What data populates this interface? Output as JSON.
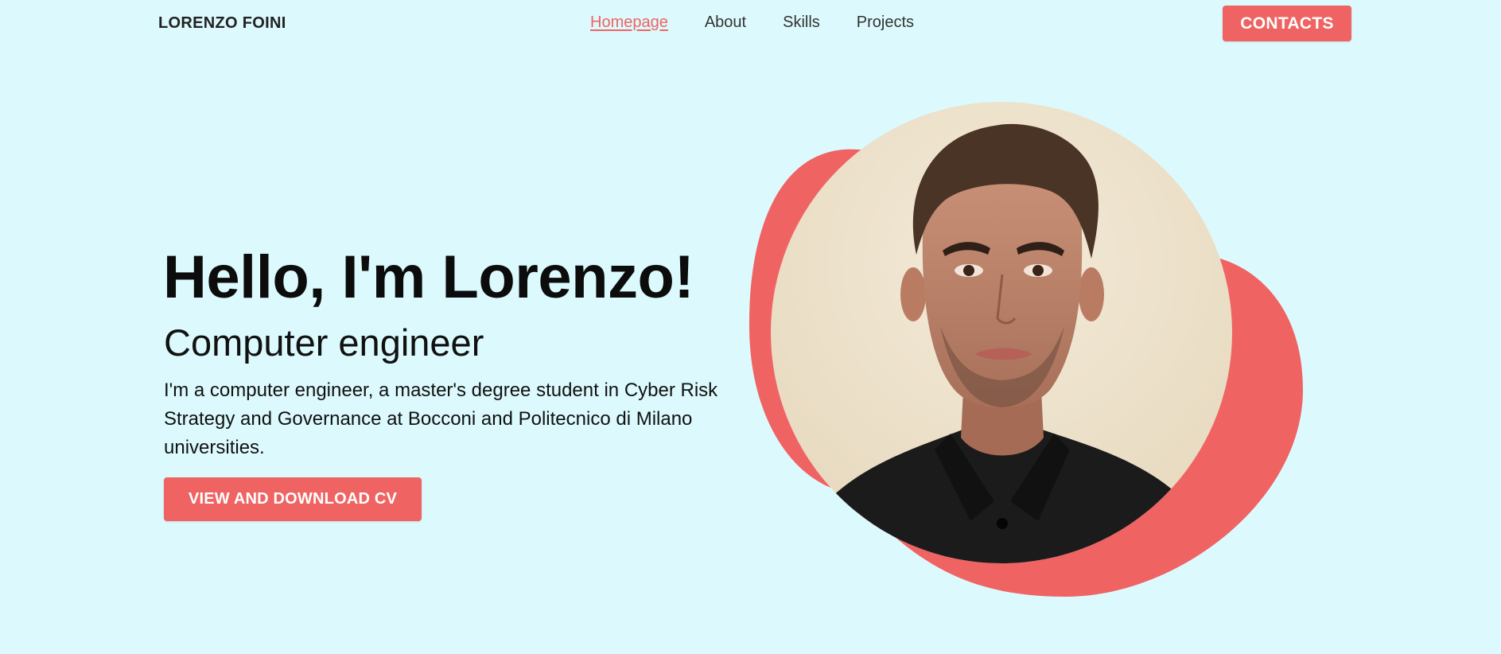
{
  "header": {
    "brand": "LORENZO FOINI",
    "nav": [
      {
        "label": "Homepage",
        "active": true
      },
      {
        "label": "About",
        "active": false
      },
      {
        "label": "Skills",
        "active": false
      },
      {
        "label": "Projects",
        "active": false
      }
    ],
    "contacts_label": "CONTACTS"
  },
  "hero": {
    "title": "Hello, I'm Lorenzo!",
    "subtitle": "Computer engineer",
    "description": "I'm a computer engineer, a master's degree student in Cyber Risk Strategy and Governance at Bocconi and Politecnico di Milano universities.",
    "cv_button": "VIEW AND DOWNLOAD CV"
  },
  "colors": {
    "background": "#dcfafd",
    "accent": "#f06363",
    "text": "#111111"
  },
  "icons": {
    "profile_photo": "portrait-photo"
  }
}
